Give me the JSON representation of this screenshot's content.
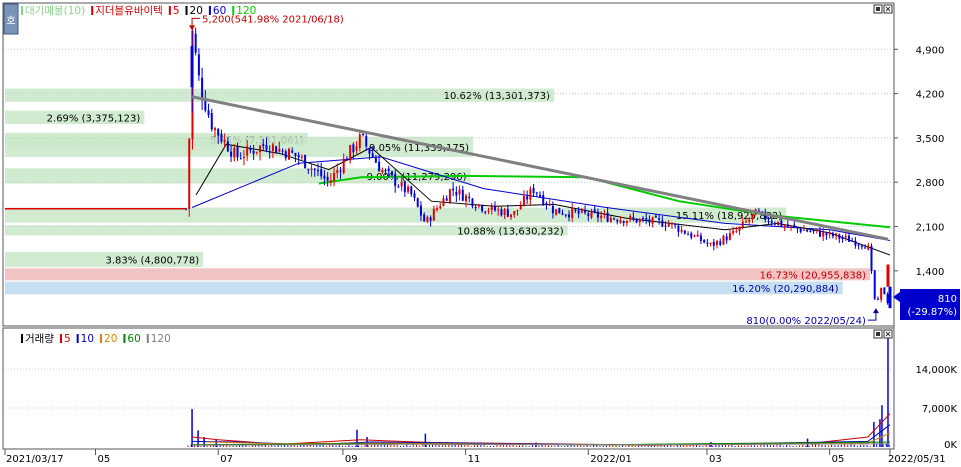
{
  "corner_label": "호",
  "price_legend": {
    "items": [
      {
        "label": "대기매물(10)",
        "color": "#8fd08f"
      },
      {
        "label": "지더블유바이텍",
        "color": "#d00000"
      },
      {
        "label": "5",
        "color": "#d00000"
      },
      {
        "label": "20",
        "color": "#000000"
      },
      {
        "label": "60",
        "color": "#0000cc"
      },
      {
        "label": "120",
        "color": "#00cc00"
      }
    ]
  },
  "volume_legend": {
    "items": [
      {
        "label": "거래량",
        "color": "#000000"
      },
      {
        "label": "5",
        "color": "#d00000"
      },
      {
        "label": "10",
        "color": "#0000cc"
      },
      {
        "label": "20",
        "color": "#e08000"
      },
      {
        "label": "60",
        "color": "#008000"
      },
      {
        "label": "120",
        "color": "#808080"
      }
    ]
  },
  "colors": {
    "up": "#e00000",
    "down": "#0000dd",
    "ma5": "#d00000",
    "ma20": "#000000",
    "ma60": "#0000cc",
    "ma120": "#00cc00",
    "trendline": "#808080"
  },
  "chart_data": {
    "type": "candlestick",
    "stock": "지더블유바이텍",
    "price_axis": {
      "ticks": [
        4900,
        4200,
        3500,
        2800,
        2100,
        1400
      ],
      "tick_labels": [
        "4,900",
        "4,200",
        "3,500",
        "2,800",
        "2,100",
        "1,400"
      ],
      "ylim": [
        560,
        5600
      ]
    },
    "volume_axis": {
      "ticks": [
        14000,
        7000,
        0
      ],
      "tick_labels": [
        "14,000K",
        "7,000K",
        "0K"
      ],
      "ylim": [
        0,
        21000
      ]
    },
    "x_axis": {
      "start": "2021-03-17",
      "end": "2022-05-31",
      "labels": [
        "2021/03/17",
        "05",
        "07",
        "09",
        "11",
        "2022/01",
        "03",
        "05",
        "2022/05/31"
      ]
    },
    "volume_profile": [
      {
        "label": "10.62% (13,301,373)",
        "low": 4070,
        "high": 4280
      },
      {
        "label": "2.69% (3,375,123)",
        "low": 3720,
        "high": 3930
      },
      {
        "label": "5.85% (7,331,061)",
        "low": 3370,
        "high": 3580
      },
      {
        "label": "9.05% (11,339,175)",
        "low": 3200,
        "high": 3520
      },
      {
        "label": "9.00% (11,279,296)",
        "low": 2780,
        "high": 3020
      },
      {
        "label": "15.11% (18,925,882)",
        "low": 2160,
        "high": 2400
      },
      {
        "label": "10.88% (13,630,232)",
        "low": 1960,
        "high": 2120
      },
      {
        "label": "3.83% (4,800,778)",
        "low": 1460,
        "high": 1700
      },
      {
        "label": "16.73% (20,955,838)",
        "low": 1250,
        "high": 1440
      },
      {
        "label": "16.20% (20,290,884)",
        "low": 1030,
        "high": 1230
      }
    ],
    "annotations": [
      {
        "label": "5,200(541.98% 2021/06/18)",
        "date": "2021-06-18",
        "value": 5200
      },
      {
        "label": "810(0.00% 2022/05/24)",
        "date": "2022-05-24",
        "value": 810
      }
    ],
    "last_price": {
      "label": "810",
      "change": "(-29.87%)"
    },
    "trendline": {
      "from": {
        "date": "2021-06-18",
        "value": 4150
      },
      "to": {
        "date": "2022-05-30",
        "value": 1900
      }
    },
    "price_path": [
      {
        "date": "2021-03-17",
        "value": 2380
      },
      {
        "date": "2021-06-15",
        "value": 2380
      },
      {
        "date": "2021-06-16",
        "value": 2900
      },
      {
        "date": "2021-06-17",
        "value": 3900
      },
      {
        "date": "2021-06-18",
        "value": 5200
      },
      {
        "date": "2021-06-22",
        "value": 4300
      },
      {
        "date": "2021-06-28",
        "value": 3700
      },
      {
        "date": "2021-07-10",
        "value": 3200
      },
      {
        "date": "2021-07-25",
        "value": 3400
      },
      {
        "date": "2021-08-10",
        "value": 3200
      },
      {
        "date": "2021-08-25",
        "value": 2800
      },
      {
        "date": "2021-09-05",
        "value": 3300
      },
      {
        "date": "2021-09-10",
        "value": 3500
      },
      {
        "date": "2021-09-20",
        "value": 3000
      },
      {
        "date": "2021-10-05",
        "value": 2600
      },
      {
        "date": "2021-10-12",
        "value": 2150
      },
      {
        "date": "2021-10-25",
        "value": 2700
      },
      {
        "date": "2021-11-10",
        "value": 2400
      },
      {
        "date": "2021-11-25",
        "value": 2300
      },
      {
        "date": "2021-12-05",
        "value": 2700
      },
      {
        "date": "2021-12-15",
        "value": 2350
      },
      {
        "date": "2022-01-10",
        "value": 2250
      },
      {
        "date": "2022-02-10",
        "value": 2150
      },
      {
        "date": "2022-03-03",
        "value": 1800
      },
      {
        "date": "2022-03-15",
        "value": 2000
      },
      {
        "date": "2022-03-25",
        "value": 2300
      },
      {
        "date": "2022-04-10",
        "value": 2100
      },
      {
        "date": "2022-05-10",
        "value": 1900
      },
      {
        "date": "2022-05-20",
        "value": 1800
      },
      {
        "date": "2022-05-24",
        "value": 810
      },
      {
        "date": "2022-05-27",
        "value": 1150
      },
      {
        "date": "2022-05-31",
        "value": 810
      }
    ],
    "ma_paths": {
      "ma20": [
        {
          "date": "2021-06-20",
          "value": 2600
        },
        {
          "date": "2021-07-05",
          "value": 3400
        },
        {
          "date": "2021-08-01",
          "value": 3250
        },
        {
          "date": "2021-08-25",
          "value": 3000
        },
        {
          "date": "2021-09-15",
          "value": 3350
        },
        {
          "date": "2021-10-15",
          "value": 2500
        },
        {
          "date": "2021-11-15",
          "value": 2420
        },
        {
          "date": "2021-12-15",
          "value": 2450
        },
        {
          "date": "2022-01-20",
          "value": 2230
        },
        {
          "date": "2022-03-10",
          "value": 2050
        },
        {
          "date": "2022-04-05",
          "value": 2150
        },
        {
          "date": "2022-05-01",
          "value": 2000
        },
        {
          "date": "2022-05-31",
          "value": 1650
        }
      ],
      "ma60": [
        {
          "date": "2021-06-18",
          "value": 2400
        },
        {
          "date": "2021-08-10",
          "value": 3100
        },
        {
          "date": "2021-09-20",
          "value": 3200
        },
        {
          "date": "2021-11-10",
          "value": 2700
        },
        {
          "date": "2022-01-10",
          "value": 2400
        },
        {
          "date": "2022-03-10",
          "value": 2150
        },
        {
          "date": "2022-05-01",
          "value": 2050
        },
        {
          "date": "2022-05-31",
          "value": 1880
        }
      ],
      "ma120": [
        {
          "date": "2021-08-20",
          "value": 2780
        },
        {
          "date": "2021-09-10",
          "value": 2880
        },
        {
          "date": "2021-11-01",
          "value": 2900
        },
        {
          "date": "2021-12-31",
          "value": 2880
        },
        {
          "date": "2022-02-15",
          "value": 2500
        },
        {
          "date": "2022-04-01",
          "value": 2280
        },
        {
          "date": "2022-05-31",
          "value": 2090
        }
      ]
    },
    "volume_spikes": [
      {
        "date": "2021-06-18",
        "value": 6800
      },
      {
        "date": "2021-06-21",
        "value": 3000
      },
      {
        "date": "2021-06-24",
        "value": 1800
      },
      {
        "date": "2021-06-30",
        "value": 1300
      },
      {
        "date": "2021-09-08",
        "value": 3100
      },
      {
        "date": "2021-09-13",
        "value": 1800
      },
      {
        "date": "2021-10-12",
        "value": 2400
      },
      {
        "date": "2021-12-06",
        "value": 800
      },
      {
        "date": "2022-03-03",
        "value": 900
      },
      {
        "date": "2022-04-20",
        "value": 1500
      },
      {
        "date": "2022-05-23",
        "value": 4500
      },
      {
        "date": "2022-05-26",
        "value": 5000
      },
      {
        "date": "2022-05-27",
        "value": 7500
      },
      {
        "date": "2022-05-30",
        "value": 20500
      }
    ]
  }
}
